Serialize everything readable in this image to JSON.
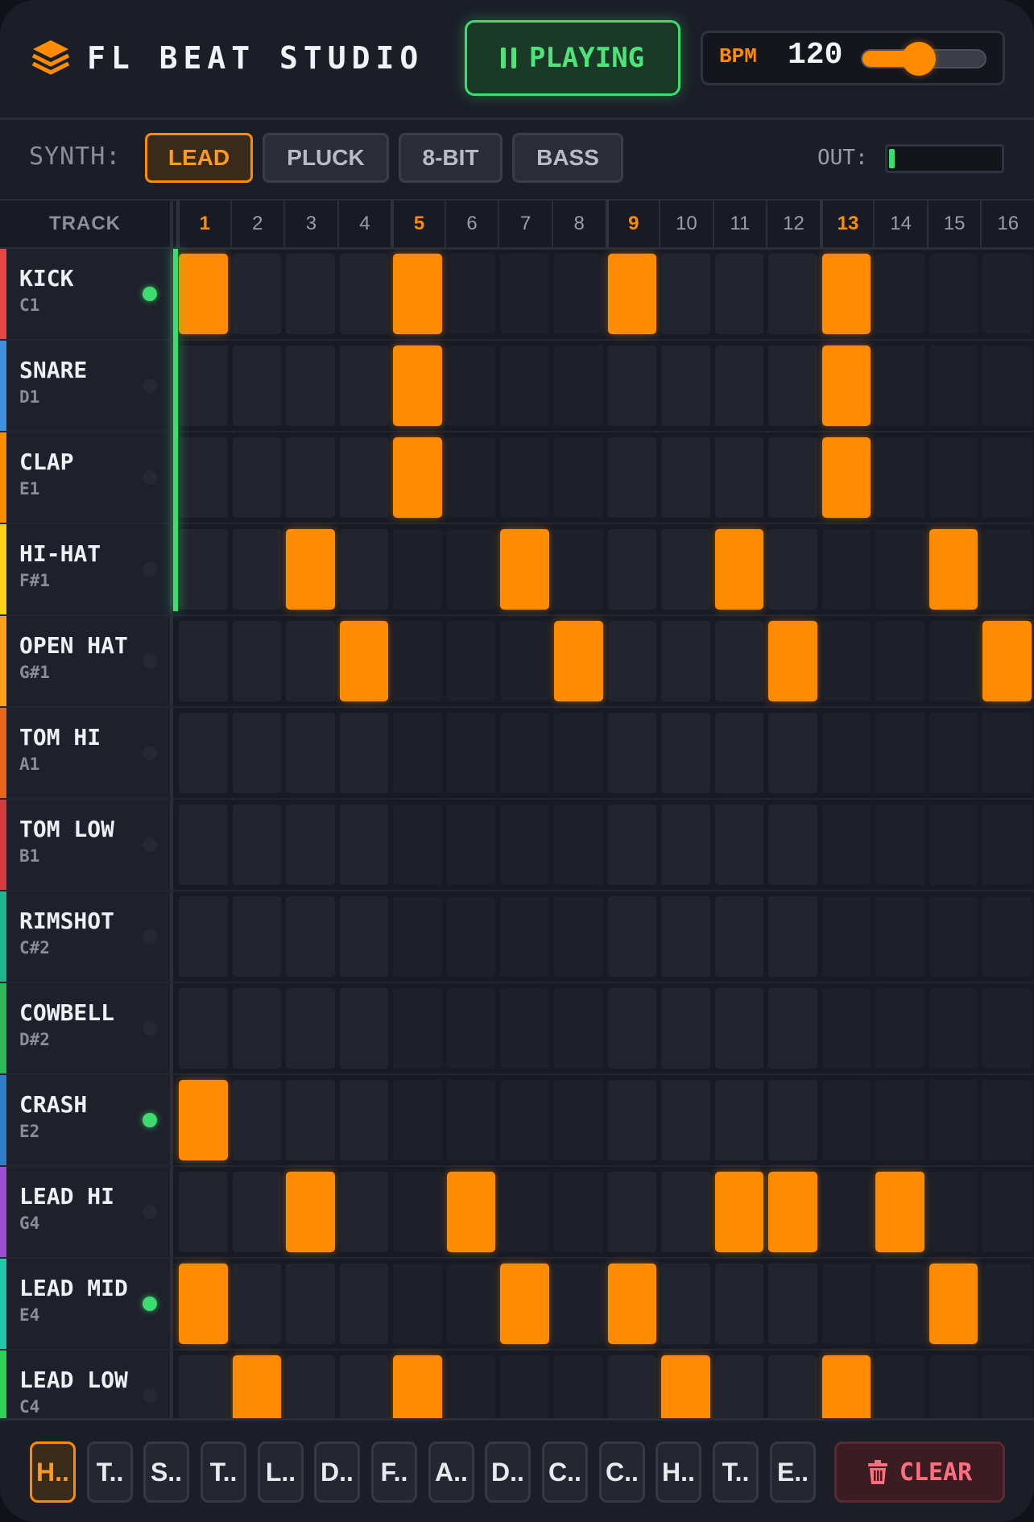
{
  "header": {
    "title": "FL BEAT STUDIO",
    "play_label": "PLAYING",
    "bpm_label": "BPM",
    "bpm_value": "120",
    "bpm_slider_fraction": 0.42
  },
  "synth": {
    "label": "SYNTH:",
    "options": [
      "LEAD",
      "PLUCK",
      "8-BIT",
      "BASS"
    ],
    "active_index": 0,
    "out_label": "OUT:",
    "out_level_fraction": 0.05
  },
  "grid": {
    "track_header": "TRACK",
    "steps": [
      "1",
      "2",
      "3",
      "4",
      "5",
      "6",
      "7",
      "8",
      "9",
      "10",
      "11",
      "12",
      "13",
      "14",
      "15",
      "16"
    ],
    "beat_steps": [
      1,
      5,
      9,
      13
    ],
    "current_step": 1,
    "tracks": [
      {
        "name": "KICK",
        "note": "C1",
        "color": "#e84545",
        "led": true,
        "pattern": [
          1,
          0,
          0,
          0,
          1,
          0,
          0,
          0,
          1,
          0,
          0,
          0,
          1,
          0,
          0,
          0
        ]
      },
      {
        "name": "SNARE",
        "note": "D1",
        "color": "#3d8fe0",
        "led": false,
        "pattern": [
          0,
          0,
          0,
          0,
          1,
          0,
          0,
          0,
          0,
          0,
          0,
          0,
          1,
          0,
          0,
          0
        ]
      },
      {
        "name": "CLAP",
        "note": "E1",
        "color": "#ff8c00",
        "led": false,
        "pattern": [
          0,
          0,
          0,
          0,
          1,
          0,
          0,
          0,
          0,
          0,
          0,
          0,
          1,
          0,
          0,
          0
        ]
      },
      {
        "name": "HI-HAT",
        "note": "F#1",
        "color": "#ffd21a",
        "led": false,
        "pattern": [
          0,
          0,
          1,
          0,
          0,
          0,
          1,
          0,
          0,
          0,
          1,
          0,
          0,
          0,
          1,
          0
        ]
      },
      {
        "name": "OPEN HAT",
        "note": "G#1",
        "color": "#ffa21a",
        "led": false,
        "pattern": [
          0,
          0,
          0,
          1,
          0,
          0,
          0,
          1,
          0,
          0,
          0,
          1,
          0,
          0,
          0,
          1
        ]
      },
      {
        "name": "TOM HI",
        "note": "A1",
        "color": "#e8641a",
        "led": false,
        "pattern": [
          0,
          0,
          0,
          0,
          0,
          0,
          0,
          0,
          0,
          0,
          0,
          0,
          0,
          0,
          0,
          0
        ]
      },
      {
        "name": "TOM LOW",
        "note": "B1",
        "color": "#d63a3a",
        "led": false,
        "pattern": [
          0,
          0,
          0,
          0,
          0,
          0,
          0,
          0,
          0,
          0,
          0,
          0,
          0,
          0,
          0,
          0
        ]
      },
      {
        "name": "RIMSHOT",
        "note": "C#2",
        "color": "#1fb58a",
        "led": false,
        "pattern": [
          0,
          0,
          0,
          0,
          0,
          0,
          0,
          0,
          0,
          0,
          0,
          0,
          0,
          0,
          0,
          0
        ]
      },
      {
        "name": "COWBELL",
        "note": "D#2",
        "color": "#2fb55a",
        "led": false,
        "pattern": [
          0,
          0,
          0,
          0,
          0,
          0,
          0,
          0,
          0,
          0,
          0,
          0,
          0,
          0,
          0,
          0
        ]
      },
      {
        "name": "CRASH",
        "note": "E2",
        "color": "#2f7fc8",
        "led": true,
        "pattern": [
          1,
          0,
          0,
          0,
          0,
          0,
          0,
          0,
          0,
          0,
          0,
          0,
          0,
          0,
          0,
          0
        ]
      },
      {
        "name": "LEAD HI",
        "note": "G4",
        "color": "#9a4ed6",
        "led": false,
        "pattern": [
          0,
          0,
          1,
          0,
          0,
          1,
          0,
          0,
          0,
          0,
          1,
          1,
          0,
          1,
          0,
          0
        ]
      },
      {
        "name": "LEAD MID",
        "note": "E4",
        "color": "#1fc8a8",
        "led": true,
        "pattern": [
          1,
          0,
          0,
          0,
          0,
          0,
          1,
          0,
          1,
          0,
          0,
          0,
          0,
          0,
          1,
          0
        ]
      },
      {
        "name": "LEAD LOW",
        "note": "C4",
        "color": "#2fd15a",
        "led": false,
        "pattern": [
          0,
          1,
          0,
          0,
          1,
          0,
          0,
          0,
          0,
          1,
          0,
          0,
          1,
          0,
          0,
          0
        ]
      }
    ]
  },
  "bottom": {
    "tabs": [
      "H..",
      "T..",
      "S..",
      "T..",
      "L..",
      "D..",
      "F..",
      "A..",
      "D..",
      "C..",
      "C..",
      "H..",
      "T..",
      "E.."
    ],
    "active_tab": 0,
    "clear_label": "CLEAR"
  },
  "colors": {
    "accent": "#ff8c00",
    "playing": "#3ddc6e",
    "danger": "#ff6f7d"
  }
}
